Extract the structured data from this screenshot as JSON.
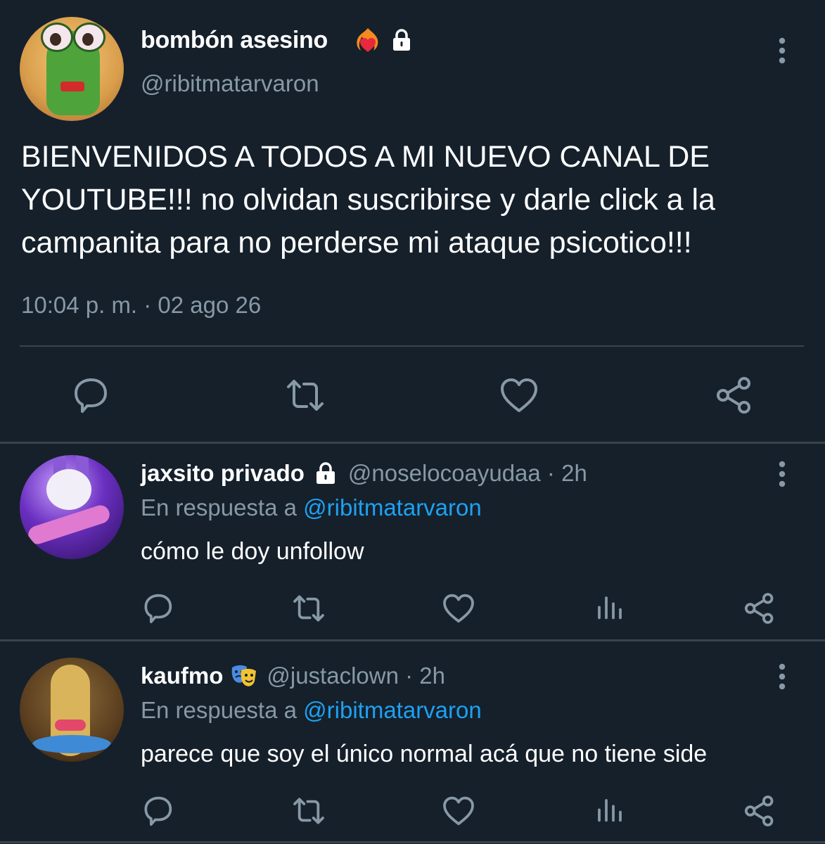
{
  "colors": {
    "background": "#15202b",
    "text_primary": "#ffffff",
    "text_secondary": "#8899a6",
    "accent": "#1da1f2",
    "divider": "#38444d"
  },
  "main_tweet": {
    "display_name": "bombón asesino",
    "handle": "@ribitmatarvaron",
    "badges": [
      "heart-on-fire-emoji",
      "lock-icon"
    ],
    "text": "BIENVENIDOS A TODOS A MI NUEVO CANAL DE YOUTUBE!!! no olvidan suscribirse y darle click a la campanita para no perderse mi ataque psicotico!!!",
    "timestamp": "10:04 p. m. · 02 ago 26",
    "actions": [
      "reply-icon",
      "retweet-icon",
      "like-icon",
      "share-icon"
    ]
  },
  "replies": [
    {
      "display_name": "jaxsito privado",
      "handle_time": "@noselocoayudaa · 2h",
      "badge": "lock-icon",
      "reply_prefix": "En respuesta a ",
      "reply_mention": "@ribitmatarvaron",
      "text": "cómo le doy unfollow",
      "actions": [
        "reply-icon",
        "retweet-icon",
        "like-icon",
        "analytics-icon",
        "share-icon"
      ]
    },
    {
      "display_name": "kaufmo",
      "handle_time": "@justaclown · 2h",
      "badge": "performing-arts-emoji",
      "reply_prefix": "En respuesta a ",
      "reply_mention": "@ribitmatarvaron",
      "text": "parece que soy el único normal acá que no tiene side",
      "actions": [
        "reply-icon",
        "retweet-icon",
        "like-icon",
        "analytics-icon",
        "share-icon"
      ]
    }
  ]
}
